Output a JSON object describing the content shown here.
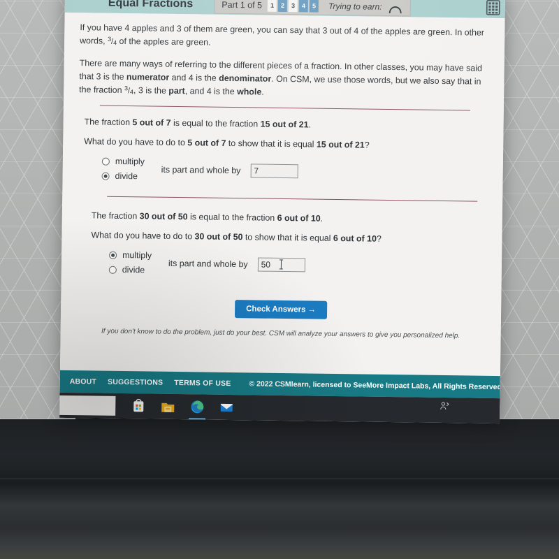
{
  "header": {
    "title": "Equal Fractions",
    "part_label": "Part 1 of 5",
    "steps": [
      {
        "number": "1",
        "state": "undone"
      },
      {
        "number": "2",
        "state": "done"
      },
      {
        "number": "3",
        "state": "undone"
      },
      {
        "number": "4",
        "state": "done"
      },
      {
        "number": "5",
        "state": "done"
      }
    ],
    "earn_label": "Trying to earn:",
    "arch_icon": "arch-badge-icon",
    "grid_icon": "calculator-icon"
  },
  "lesson": {
    "paragraph_1_a": "If you have 4 apples and 3 of them are green, you can say that 3 out of 4 of the apples are green. In other words, ",
    "paragraph_1_frac_num": "3",
    "paragraph_1_frac_den": "4",
    "paragraph_1_b": " of the apples are green.",
    "paragraph_2_a": "There are many ways of referring to the different pieces of a fraction. In other classes, you may have said that 3 is the ",
    "paragraph_2_b": "numerator",
    "paragraph_2_c": " and 4 is the ",
    "paragraph_2_d": "denominator",
    "paragraph_2_e": ". On CSM, we use those words, but we also say that in the fraction ",
    "paragraph_2_frac_num": "3",
    "paragraph_2_frac_den": "4",
    "paragraph_2_f": ", 3 is the ",
    "paragraph_2_g": "part",
    "paragraph_2_h": ", and 4 is the ",
    "paragraph_2_i": "whole",
    "paragraph_2_j": "."
  },
  "questions": [
    {
      "statement_a": "The fraction ",
      "statement_frac_1": "5 out of 7",
      "statement_b": " is equal to the fraction ",
      "statement_frac_2": "15 out of 21",
      "statement_c": ".",
      "prompt_a": "What do you have to do to ",
      "prompt_frac_1": "5 out of 7",
      "prompt_b": " to show that it is equal ",
      "prompt_frac_2": "15 out of 21",
      "prompt_c": "?",
      "option_multiply": "multiply",
      "option_divide": "divide",
      "selected": "divide",
      "by_label": "its part and whole by",
      "input_value": "7",
      "input_placeholder": "",
      "cursor_visible": false
    },
    {
      "statement_a": "The fraction ",
      "statement_frac_1": "30 out of 50",
      "statement_b": " is equal to the fraction ",
      "statement_frac_2": "6 out of 10",
      "statement_c": ".",
      "prompt_a": "What do you have to do to ",
      "prompt_frac_1": "30 out of 50",
      "prompt_b": " to show that it is equal ",
      "prompt_frac_2": "6 out of 10",
      "prompt_c": "?",
      "option_multiply": "multiply",
      "option_divide": "divide",
      "selected": "multiply",
      "by_label": "its part and whole by",
      "input_value": "50",
      "input_placeholder": "",
      "cursor_visible": true
    }
  ],
  "actions": {
    "check_answers_label": "Check Answers →",
    "hint_text": "If you don't know to do the problem, just do your best. CSM will analyze your answers to give you personalized help."
  },
  "footer": {
    "link_about": "ABOUT",
    "link_suggestions": "SUGGESTIONS",
    "link_terms": "TERMS OF USE",
    "copyright": "© 2022 CSMlearn, licensed to SeeMore Impact Labs, All Rights Reserved"
  },
  "taskbar": {
    "items": [
      {
        "name": "microsoft-store-icon",
        "active": false
      },
      {
        "name": "file-explorer-icon",
        "active": false
      },
      {
        "name": "microsoft-edge-icon",
        "active": true
      },
      {
        "name": "mail-icon",
        "active": false
      }
    ],
    "share-icon": "people-share-icon"
  },
  "colors": {
    "header_teal": "#a9cfcd",
    "footer_teal": "#187a85",
    "accent_blue": "#1b7cc2",
    "step_blue": "#6699bd",
    "divider_maroon": "#8d4f66",
    "page_bg": "#f3f2f0"
  }
}
